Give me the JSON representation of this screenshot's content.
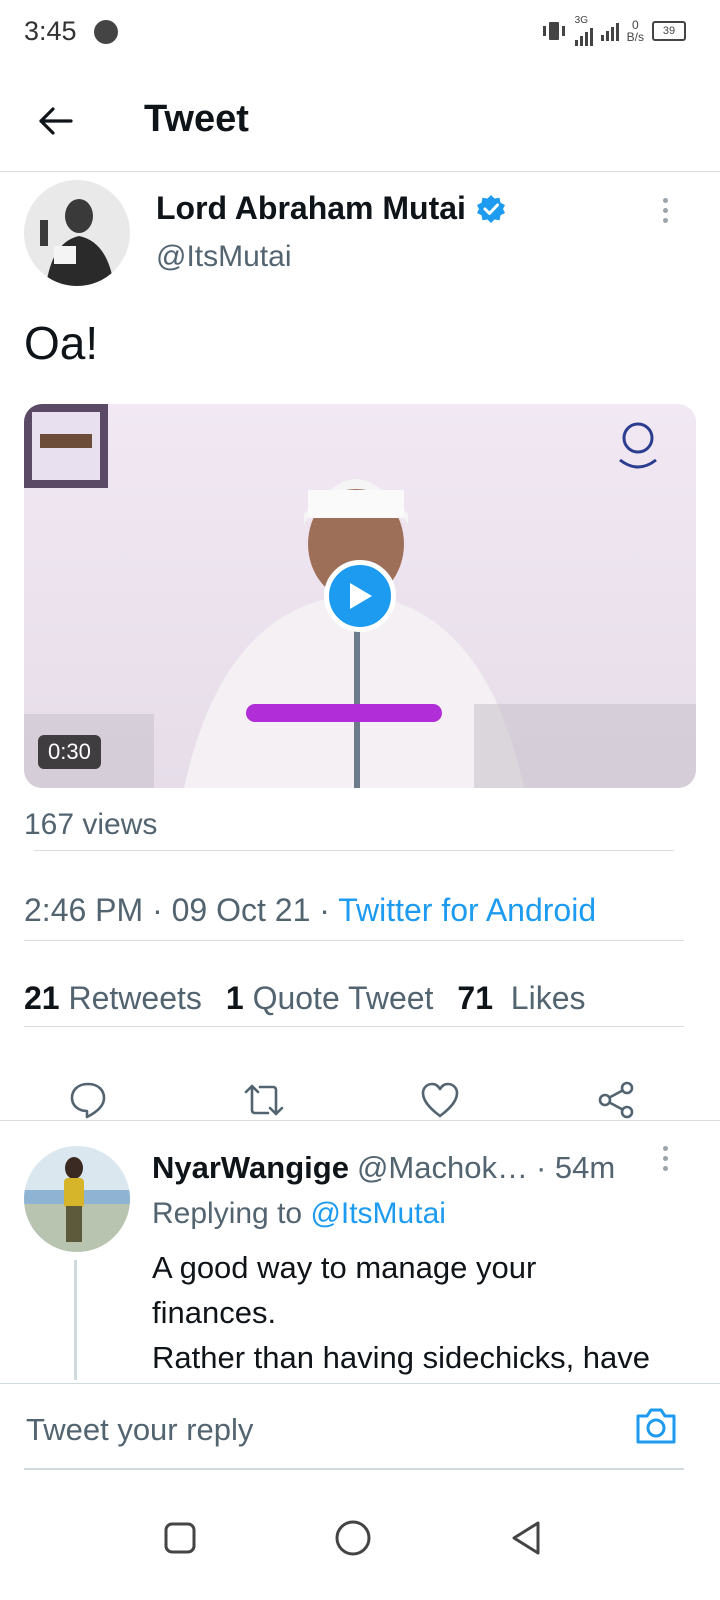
{
  "status_bar": {
    "time": "3:45",
    "network": "3G",
    "speed_top": "0",
    "speed_bottom": "B/s",
    "battery": "39"
  },
  "header": {
    "title": "Tweet"
  },
  "tweet": {
    "author_name": "Lord Abraham Mutai",
    "author_handle": "@ItsMutai",
    "verified": true,
    "text": "Oa!",
    "video_duration": "0:30",
    "views": "167 views",
    "time": "2:46 PM",
    "date": "09 Oct 21",
    "source": "Twitter for Android",
    "retweets_count": "21",
    "retweets_label": "Retweets",
    "quotes_count": "1",
    "quotes_label": "Quote Tweet",
    "likes_count": "71",
    "likes_label": "Likes"
  },
  "reply": {
    "name": "NyarWangige",
    "handle": "@Machok…",
    "time": "· 54m",
    "replying_prefix": "Replying to",
    "replying_to": "@ItsMutai",
    "line1": "A good way to manage your",
    "line2": "finances.",
    "line3": "Rather than having sidechicks, have"
  },
  "composer": {
    "placeholder": "Tweet your reply"
  },
  "colors": {
    "accent": "#1d9bf0",
    "text": "#0f1419",
    "muted": "#536471"
  }
}
